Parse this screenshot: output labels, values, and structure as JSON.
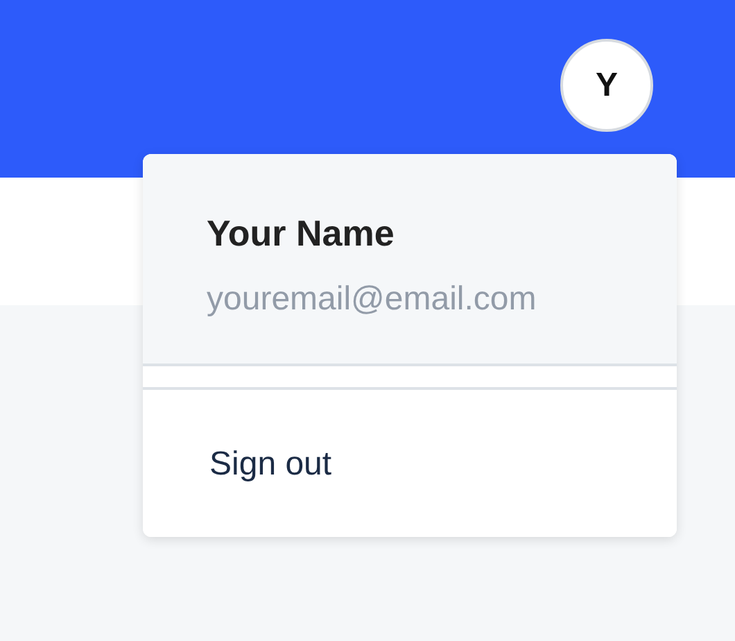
{
  "header": {
    "avatar": {
      "initial": "Y"
    }
  },
  "user_menu": {
    "open": true,
    "name": "Your Name",
    "email": "youremail@email.com",
    "items": [
      {
        "label": "Sign out"
      }
    ]
  }
}
